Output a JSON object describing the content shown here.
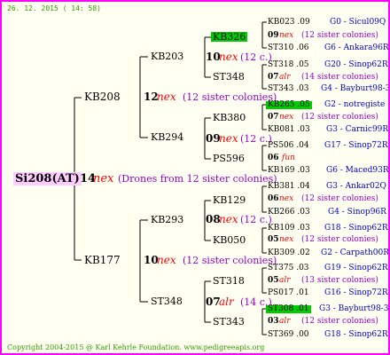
{
  "date": "26. 12. 2015 ( 14: 58)",
  "root": {
    "id": "Si208(AT)",
    "num": "14",
    "type": "nex",
    "note": "(Drones from 12 sister colonies)"
  },
  "gen1": [
    {
      "id": "KB208",
      "num": "12",
      "type": "nex",
      "note": "(12 sister colonies)"
    },
    {
      "id": "KB177",
      "num": "10",
      "type": "nex",
      "note": "(12 sister colonies)"
    }
  ],
  "gen2": [
    {
      "id": "KB203",
      "num": "10",
      "type": "nex",
      "note": "(12 c.)"
    },
    {
      "id": "KB294",
      "num": "09",
      "type": "nex",
      "note": "(12 c.)"
    },
    {
      "id": "KB293",
      "num": "08",
      "type": "nex",
      "note": "(12 c.)"
    },
    {
      "id": "ST348",
      "num": "07",
      "type": "alr",
      "note": "(14 c.)"
    }
  ],
  "gen3": [
    {
      "id": "KB326",
      "num": "09",
      "type": "nex",
      "note": "(12 sister colonies)",
      "highlight": true
    },
    {
      "id": "ST348",
      "num": "07",
      "type": "alr",
      "note": "(14 sister colonies)"
    },
    {
      "id": "KB380",
      "num": "07",
      "type": "nex",
      "note": "(12 sister colonies)"
    },
    {
      "id": "PS596",
      "num": "06",
      "type": "fun",
      "note": ""
    },
    {
      "id": "KB129",
      "num": "06",
      "type": "nex",
      "note": "(12 sister colonies)"
    },
    {
      "id": "KB050",
      "num": "05",
      "type": "nex",
      "note": "(12 sister colonies)"
    },
    {
      "id": "ST318",
      "num": "05",
      "type": "alr",
      "note": "(13 sister colonies)"
    },
    {
      "id": "ST343",
      "num": "03",
      "type": "alr",
      "note": "(12 sister colonies)"
    }
  ],
  "gen4": [
    {
      "id": "KB023 .09",
      "info": "G0 - Sicul09Q",
      "highlight": false
    },
    {
      "id": "ST310 .06",
      "info": "G6 - Ankara96R",
      "highlight": false
    },
    {
      "id": "ST318 .05",
      "info": "G20 - Sinop62R",
      "highlight": false
    },
    {
      "id": "ST343 .03",
      "info": "G4 - Bayburt98-3",
      "highlight": false
    },
    {
      "id": "KB265 .05",
      "info": "G2 - notregiste",
      "highlight": true
    },
    {
      "id": "KB081 .03",
      "info": "G3 - Carnic99R",
      "highlight": false
    },
    {
      "id": "PS506 .04",
      "info": "G17 - Sinop72R",
      "highlight": false
    },
    {
      "id": "KB169 .03",
      "info": "G6 - Maced93R",
      "highlight": false
    },
    {
      "id": "KB381 .04",
      "info": "G3 - Ankar02Q",
      "highlight": false
    },
    {
      "id": "KB266 .03",
      "info": "G4 - Sinop96R",
      "highlight": false
    },
    {
      "id": "KB109 .03",
      "info": "G18 - Sinop62R",
      "highlight": false
    },
    {
      "id": "KB309 .02",
      "info": "G2 - Carpath00R",
      "highlight": false
    },
    {
      "id": "ST375 .03",
      "info": "G19 - Sinop62R",
      "highlight": false
    },
    {
      "id": "PS017 .01",
      "info": "G16 - Sinop72R",
      "highlight": false
    },
    {
      "id": "ST308 .01",
      "info": "G3 - Bayburt98-3",
      "highlight": true
    },
    {
      "id": "ST369 .00",
      "info": "G18 - Sinop62R",
      "highlight": false
    }
  ],
  "footer": "Copyright 2004-2015 @ Karl Kehrle Foundation.   www.pedigreeapis.org",
  "colors": {
    "frame": "#ff00ff",
    "background": "#fffff2",
    "label": "#ff0000",
    "note": "#9900cc",
    "info": "#0000cc",
    "highlight": "#00cc00",
    "root_bg": "#ffccff",
    "meta": "#339900"
  }
}
